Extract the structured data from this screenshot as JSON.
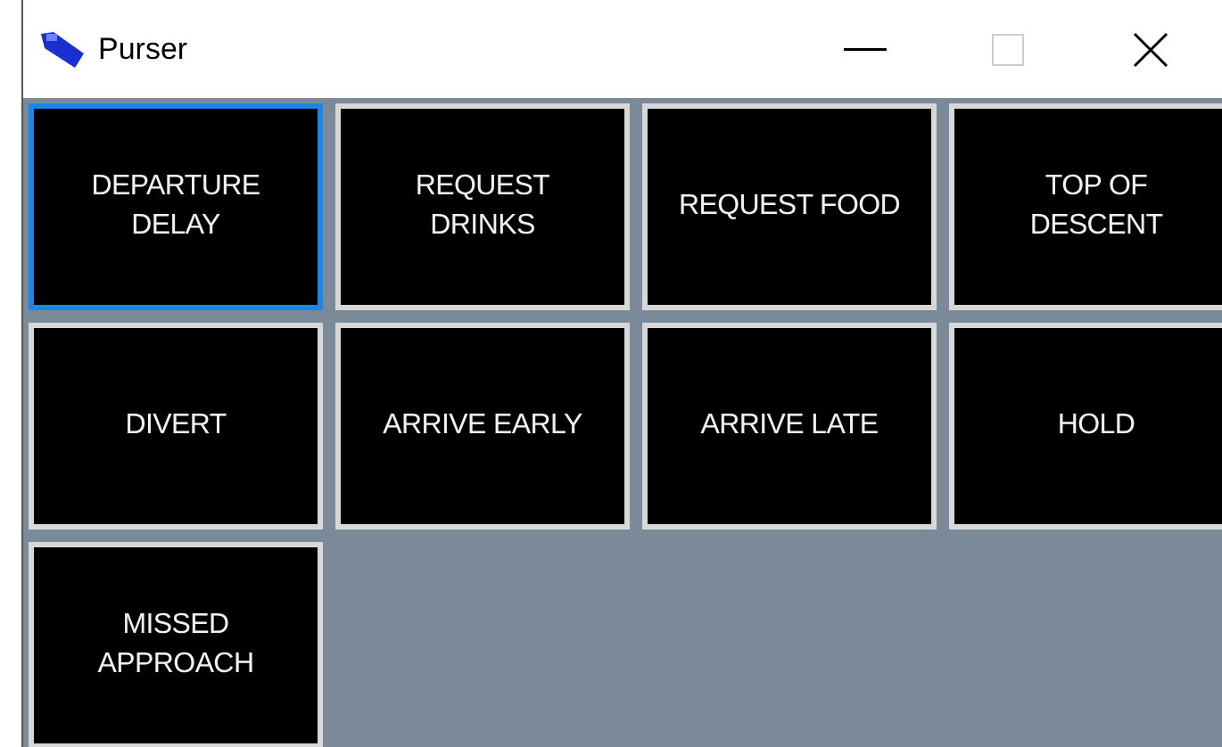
{
  "window": {
    "title": "Purser",
    "maximize_disabled": true
  },
  "buttons": [
    {
      "label": "DEPARTURE DELAY",
      "focused": true
    },
    {
      "label": "REQUEST DRINKS",
      "focused": false
    },
    {
      "label": "REQUEST FOOD",
      "focused": false
    },
    {
      "label": "TOP OF DESCENT",
      "focused": false
    },
    {
      "label": "DIVERT",
      "focused": false
    },
    {
      "label": "ARRIVE EARLY",
      "focused": false
    },
    {
      "label": "ARRIVE LATE",
      "focused": false
    },
    {
      "label": "HOLD",
      "focused": false
    },
    {
      "label": "MISSED APPROACH",
      "focused": false
    }
  ]
}
